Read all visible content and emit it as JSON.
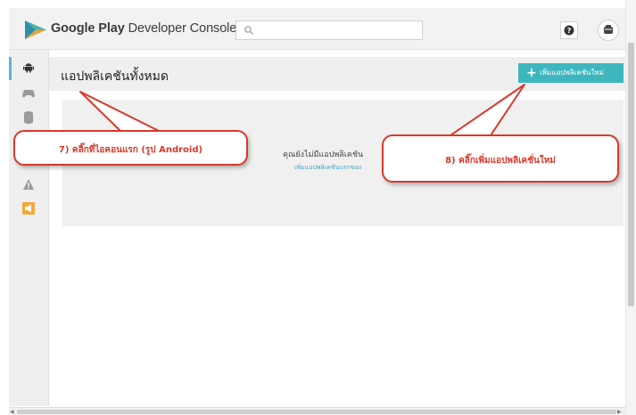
{
  "header": {
    "brand_bold": "Google Play",
    "brand_rest": " Developer Console",
    "search": {
      "placeholder": ""
    },
    "help_icon": "question-mark-icon",
    "account_icon": "account-avatar-icon"
  },
  "sidebar": {
    "items": [
      {
        "icon": "android-icon",
        "label": "All applications",
        "active": true
      },
      {
        "icon": "gamepad-icon",
        "label": "Game services",
        "active": false
      },
      {
        "icon": "database-icon",
        "label": "Reports",
        "active": false
      },
      {
        "icon": "warning-icon",
        "label": "Alerts",
        "active": false
      },
      {
        "icon": "announcement-icon",
        "label": "Announcements",
        "active": false
      }
    ]
  },
  "main": {
    "title": "แอปพลิเคชันทั้งหมด",
    "add_button": "เพิ่มแอปพลิเคชันใหม่",
    "empty_message": "คุณยังไม่มีแอปพลิเคชัน",
    "empty_link": "เพิ่มแอปพลิเคชันแรกของ"
  },
  "callouts": {
    "left": "7) คลิ๊กที่ไอคอนแรก (รูป Android)",
    "right": "8) คลิ๊กเพิ่มแอปพลิเคชั่นใหม่"
  },
  "colors": {
    "accent": "#3db7bd",
    "callout_red": "#d8392c",
    "link": "#3aa6c6",
    "active_marker": "#5bb6cf"
  }
}
